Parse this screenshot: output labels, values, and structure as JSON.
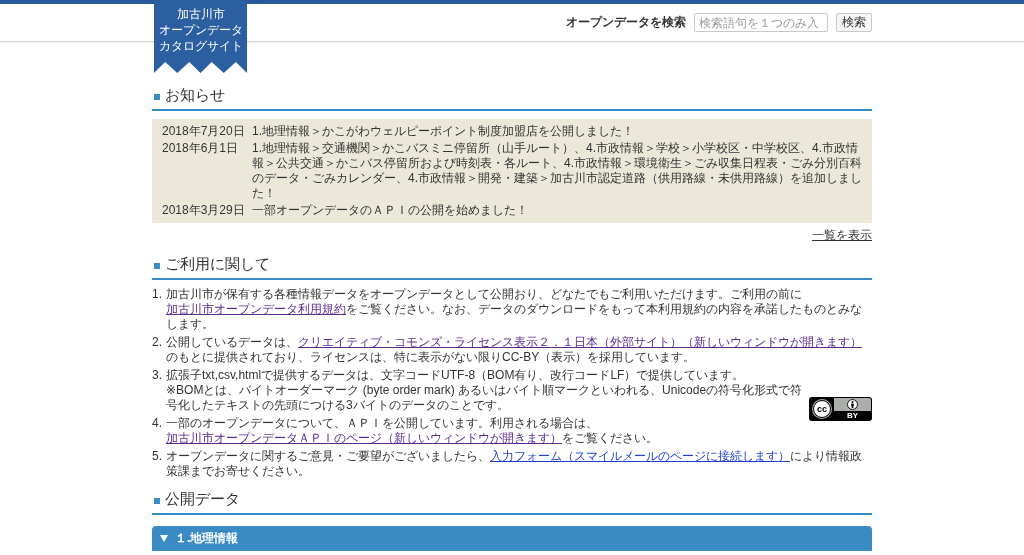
{
  "header": {
    "logo_lines": [
      "加古川市",
      "オープンデータ",
      "カタログサイト"
    ],
    "search": {
      "label": "オープンデータを検索",
      "placeholder": "検索語句を１つのみ入",
      "button": "検索"
    }
  },
  "news": {
    "heading": "お知らせ",
    "items": [
      {
        "date": "2018年7月20日",
        "text": "1.地理情報＞かこがわウェルピーポイント制度加盟店を公開しました！"
      },
      {
        "date": "2018年6月1日",
        "text": "1.地理情報＞交通機関＞かこバスミニ停留所（山手ルート）、4.市政情報＞学校＞小学校区・中学校区、4.市政情報＞公共交通＞かこバス停留所および時刻表・各ルート、4.市政情報＞環境衛生＞ごみ収集日程表・ごみ分別百科のデータ・ごみカレンダー、4.市政情報＞開発・建築＞加古川市認定道路（供用路線・未供用路線）を追加しました！"
      },
      {
        "date": "2018年3月29日",
        "text": "一部オープンデータのＡＰＩの公開を始めました！"
      }
    ],
    "more_link": "一覧を表示"
  },
  "usage": {
    "heading": "ご利用に関して",
    "items": [
      {
        "number": "1.",
        "parts": [
          {
            "kind": "text",
            "text": "加古川市が保有する各種情報データをオープンデータとして公開おり、どなたでもご利用いただけます。ご利用の前に"
          },
          {
            "kind": "link",
            "text": "加古川市オープンデータ利用規約",
            "visited": true
          },
          {
            "kind": "text",
            "text": "をご覧ください。なお、データのダウンロードをもって本利用規約の内容を承諾したものとみなします。"
          }
        ]
      },
      {
        "number": "2.",
        "parts": [
          {
            "kind": "text",
            "text": "公開しているデータは、"
          },
          {
            "kind": "link",
            "text": "クリエイティブ・コモンズ・ライセンス表示２．１日本（外部サイト）（新しいウィンドウが開きます）",
            "visited": true
          },
          {
            "kind": "text",
            "text": "のもとに提供されており、ライセンスは、特に表示がない限りCC-BY（表示）を採用しています。"
          }
        ]
      },
      {
        "number": "3.",
        "parts": [
          {
            "kind": "text",
            "text": "拡張子txt,csv,htmlで提供するデータは、文字コードUTF-8（BOM有り、改行コードLF）で提供しています。"
          }
        ],
        "note": "※BOMとは、バイトオーダーマーク (byte order mark) あるいはバイト順マークといわれる、Unicodeの符号化形式で符号化したテキストの先頭につける3バイトのデータのことです。"
      },
      {
        "number": "4.",
        "parts": [
          {
            "kind": "text",
            "text": "一部のオープンデータについて、ＡＰＩを公開しています。利用される場合は、"
          },
          {
            "kind": "link",
            "text": "加古川市オープンデータＡＰＩのページ（新しいウィンドウが開きます）",
            "visited": true
          },
          {
            "kind": "text",
            "text": "をご覧ください。"
          }
        ]
      },
      {
        "number": "5.",
        "parts": [
          {
            "kind": "text",
            "text": "オープンデータに関するご意見・ご要望がございましたら、"
          },
          {
            "kind": "link",
            "text": "入力フォーム（スマイルメールのページに接続します）",
            "visited": false
          },
          {
            "kind": "text",
            "text": "により情報政策課までお寄せください。"
          }
        ]
      }
    ],
    "license_badge": {
      "symbol": "cc",
      "label": "BY"
    }
  },
  "public_data": {
    "heading": "公開データ",
    "categories": [
      {
        "label": "１.地理情報"
      }
    ]
  }
}
